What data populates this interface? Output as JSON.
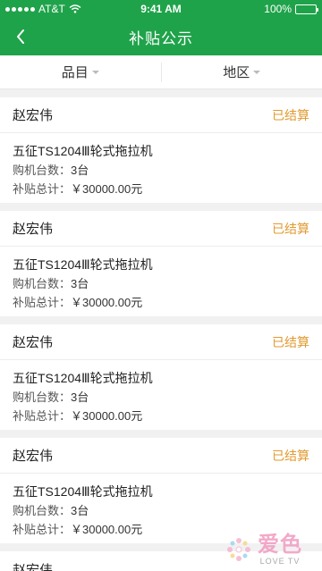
{
  "status_bar": {
    "carrier": "AT&T",
    "time": "9:41 AM",
    "battery": "100%",
    "battery_level": 1.0
  },
  "nav": {
    "title": "补贴公示"
  },
  "filters": [
    {
      "label": "品目"
    },
    {
      "label": "地区"
    }
  ],
  "records": [
    {
      "name": "赵宏伟",
      "status": "已结算",
      "product": "五征TS1204Ⅲ轮式拖拉机",
      "qty_label": "购机台数：",
      "qty_value": "3台",
      "total_label": "补贴总计：",
      "total_value": "￥30000.00元"
    },
    {
      "name": "赵宏伟",
      "status": "已结算",
      "product": "五征TS1204Ⅲ轮式拖拉机",
      "qty_label": "购机台数：",
      "qty_value": "3台",
      "total_label": "补贴总计：",
      "total_value": "￥30000.00元"
    },
    {
      "name": "赵宏伟",
      "status": "已结算",
      "product": "五征TS1204Ⅲ轮式拖拉机",
      "qty_label": "购机台数：",
      "qty_value": "3台",
      "total_label": "补贴总计：",
      "total_value": "￥30000.00元"
    },
    {
      "name": "赵宏伟",
      "status": "已结算",
      "product": "五征TS1204Ⅲ轮式拖拉机",
      "qty_label": "购机台数：",
      "qty_value": "3台",
      "total_label": "补贴总计：",
      "total_value": "￥30000.00元"
    }
  ],
  "partial_record": {
    "name": "赵宏伟"
  },
  "watermark": {
    "main": "爱色",
    "sub": "LOVE TV"
  },
  "colors": {
    "brand_green": "#1fa34a",
    "settled_orange": "#e19a2f"
  }
}
